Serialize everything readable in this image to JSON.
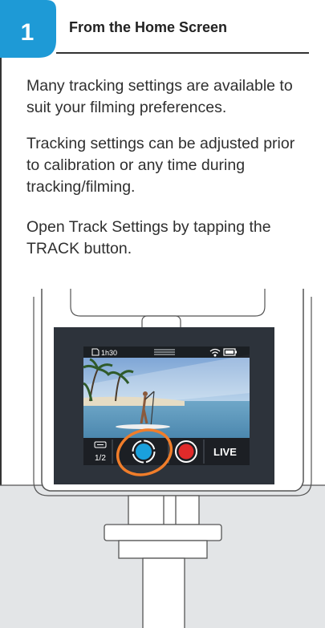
{
  "step": {
    "number": "1",
    "title": "From the Home Screen"
  },
  "paragraphs": [
    "Many tracking settings are available to suit your filming preferences.",
    "Tracking settings can be adjusted prior to calibration or any time during tracking/filming.",
    "Open Track Settings by tapping the TRACK button."
  ],
  "device": {
    "status_bar": {
      "storage_time": "1h30",
      "icons": [
        "sd-card-icon",
        "menu-lines-icon",
        "wifi-icon",
        "battery-icon"
      ]
    },
    "controls": {
      "mode_page": "1/2",
      "live_label": "LIVE",
      "icons": [
        "hdmi-icon",
        "track-button-icon",
        "record-button-icon"
      ]
    },
    "colors": {
      "badge": "#1e9ad6",
      "highlight_ring": "#f07d2a",
      "track_blue": "#1aa0dc",
      "record_red": "#e02a2a",
      "screen_frame": "#2d333b"
    }
  }
}
